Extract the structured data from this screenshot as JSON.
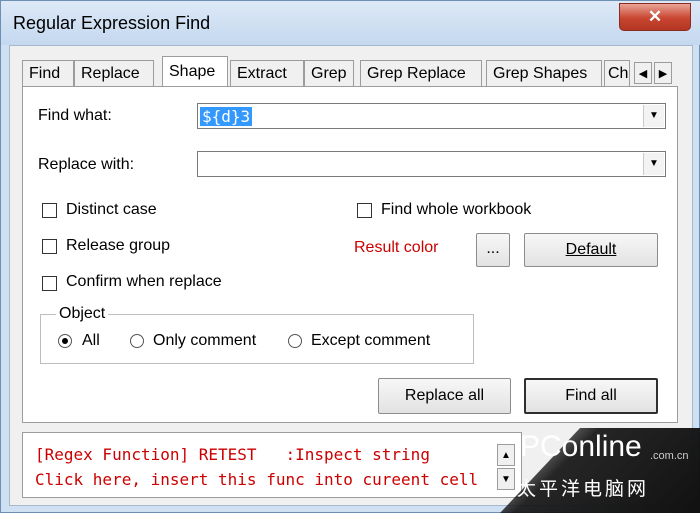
{
  "window": {
    "title": "Regular Expression Find",
    "close_symbol": "✕"
  },
  "tabs": [
    {
      "label": "Find"
    },
    {
      "label": "Replace"
    },
    {
      "label": "Shape"
    },
    {
      "label": "Extract"
    },
    {
      "label": "Grep"
    },
    {
      "label": "Grep Replace"
    },
    {
      "label": "Grep Shapes"
    },
    {
      "label": "Ch"
    }
  ],
  "active_tab": "Shape",
  "tab_scroll": {
    "left": "◀",
    "right": "▶"
  },
  "find": {
    "label": "Find what:",
    "value": "${d}3",
    "drop": "▼"
  },
  "replace": {
    "label": "Replace with:",
    "value": "",
    "drop": "▼"
  },
  "options": {
    "distinct_case": "Distinct case",
    "release_group": "Release group",
    "confirm_replace": "Confirm when replace",
    "whole_workbook": "Find whole workbook"
  },
  "result_color": {
    "label": "Result color",
    "browse": "...",
    "default": "Default",
    "color": "#cc0000"
  },
  "object_group": {
    "legend": "Object",
    "options": [
      "All",
      "Only comment",
      "Except comment"
    ],
    "selected": "All"
  },
  "actions": {
    "replace_all": "Replace all",
    "find_all": "Find all"
  },
  "status": {
    "line1": "[Regex Function] RETEST   :Inspect string",
    "line2": "Click here, insert this func into cureent cell"
  },
  "status_scroll": {
    "up": "▲",
    "down": "▼"
  },
  "watermark": {
    "brand": "PConline",
    "domain": ".com.cn",
    "tagline": "太平洋电脑网"
  }
}
